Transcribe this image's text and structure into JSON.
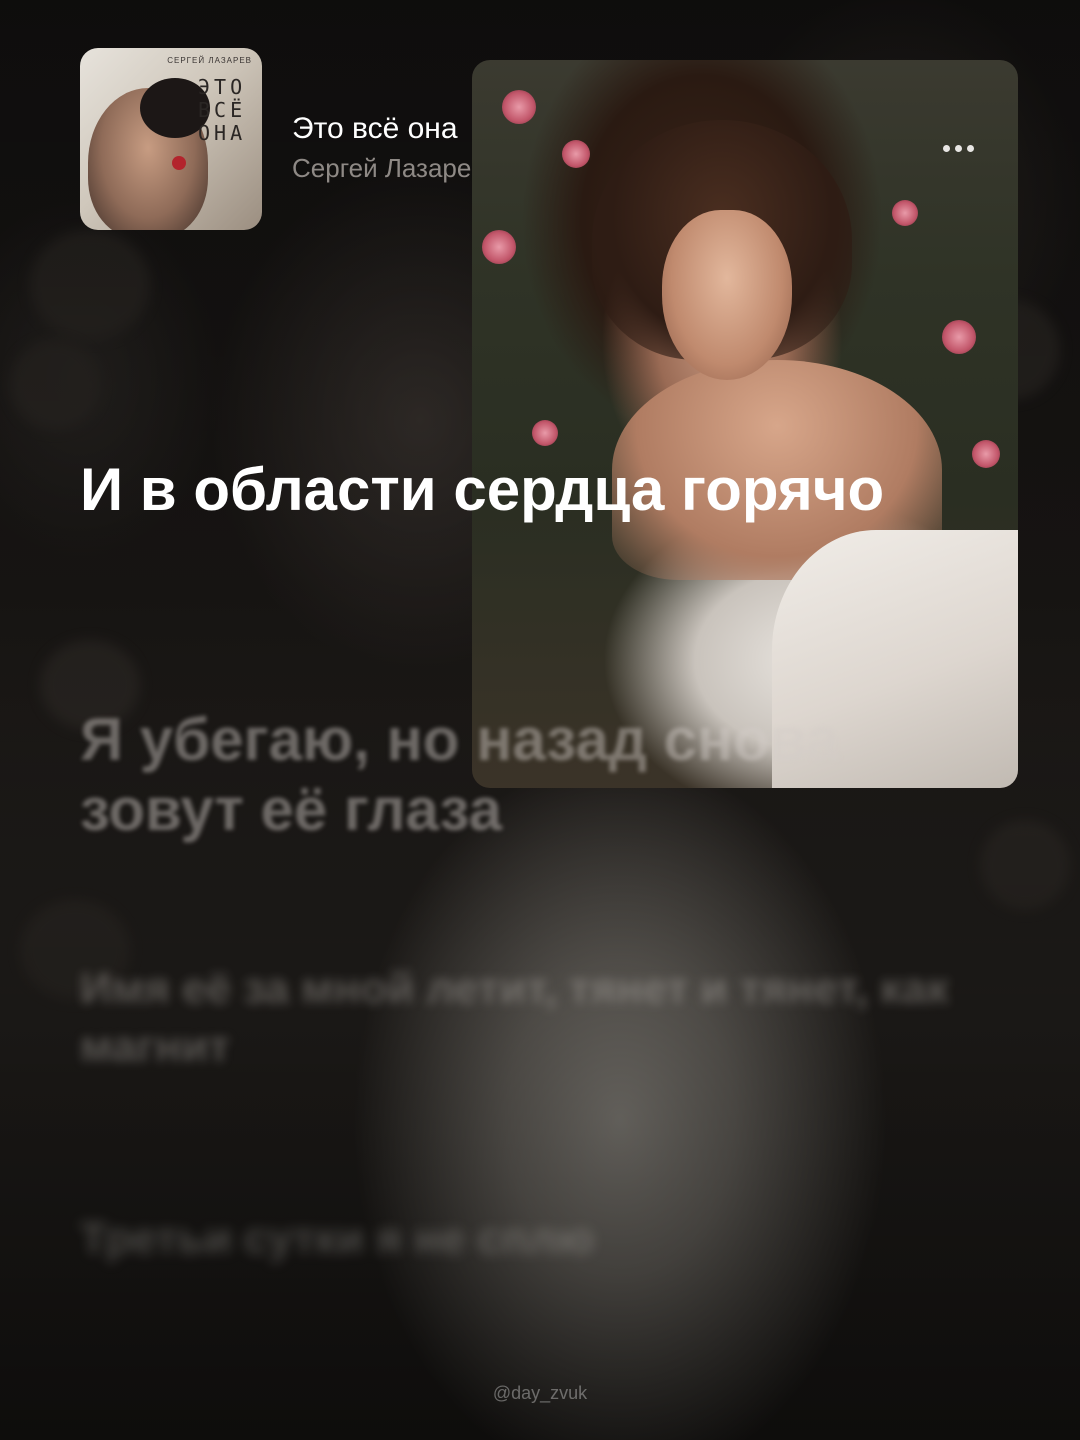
{
  "now_playing": {
    "album_cover": {
      "artist_text": "СЕРГЕЙ ЛАЗАРЕВ",
      "title_text": "ЭТО ВСЁ ОНА"
    },
    "title": "Это всё она",
    "artist": "Сергей Лазарев"
  },
  "lyrics": {
    "current_line": "И в области сердца горячо",
    "upcoming": [
      "Я убегаю, но назад снова зовут её глаза",
      "Имя её за мной летит, тянет и тянет, как магнит",
      "Третьи сутки я не сплю"
    ]
  },
  "watermark": "@day_zvuk",
  "icons": {
    "more": "more-horizontal-icon"
  }
}
